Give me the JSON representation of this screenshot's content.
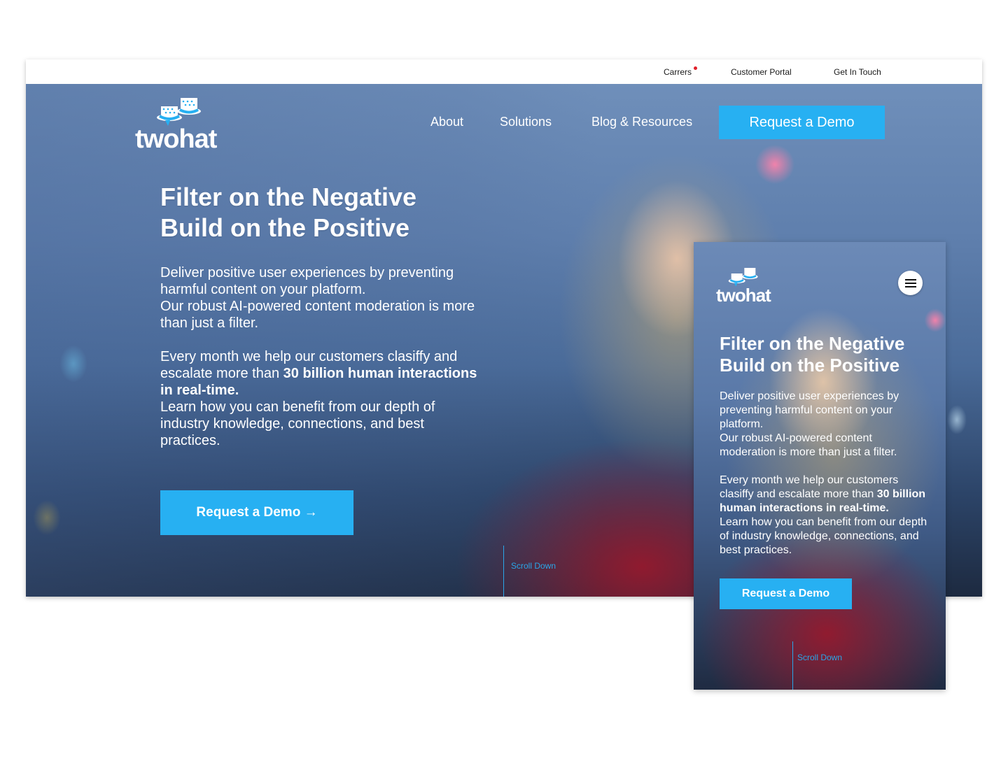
{
  "topbar": {
    "links": [
      "Carrers",
      "Customer Portal",
      "Get In Touch"
    ]
  },
  "brand": {
    "name": "twohat"
  },
  "nav": {
    "items": [
      "About",
      "Solutions",
      "Blog & Resources"
    ],
    "cta": "Request a Demo"
  },
  "hero": {
    "title_line1": "Filter on the Negative",
    "title_line2": "Build on the Positive",
    "para1_line1": "Deliver positive user experiences by preventing harmful content on your platform.",
    "para1_line2": "Our robust AI-powered content moderation is more than just a filter.",
    "para2_a": "Every month we help our customers clasiffy and escalate more than ",
    "para2_bold": "30 billion human interactions in real-time.",
    "para2_b": "Learn how you can benefit from our depth of industry knowledge, connections, and best practices.",
    "cta": "Request a Demo →",
    "scroll": "Scroll Down"
  },
  "mobile": {
    "cta": "Request a Demo",
    "scroll": "Scroll Down"
  },
  "colors": {
    "accent": "#27b0f2",
    "notification": "#e0202a"
  },
  "icons": [
    "hat-logo-icon",
    "menu-icon",
    "arrow-right-icon",
    "notification-dot-icon"
  ]
}
